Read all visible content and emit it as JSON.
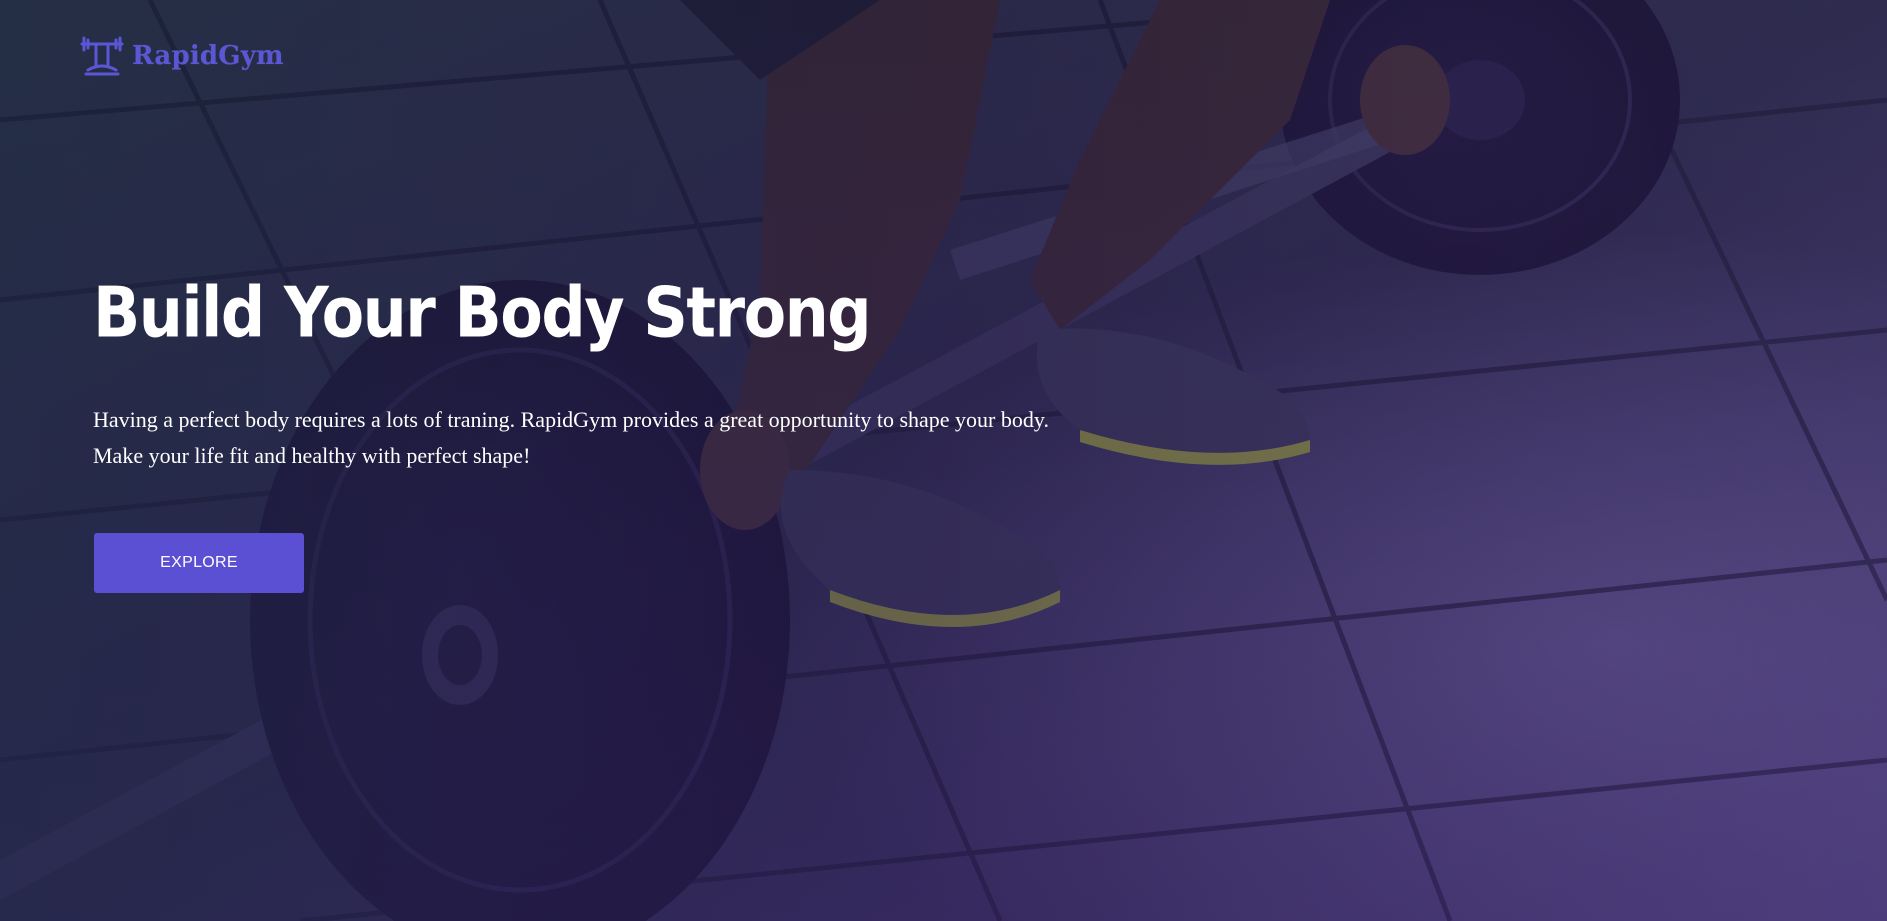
{
  "brand": {
    "name": "RapidGym",
    "logo_icon": "dumbbell-rack-icon",
    "color": "#5b56d6"
  },
  "hero": {
    "title": "Build Your Body Strong",
    "description": "Having a perfect body requires a lots of traning. RapidGym provides a great opportunity to shape your body. Make your life fit and healthy with perfect shape!",
    "cta_label": "EXPLORE",
    "cta_color": "#5b4fd4",
    "background_image": "barbell-deadlift-photo"
  }
}
